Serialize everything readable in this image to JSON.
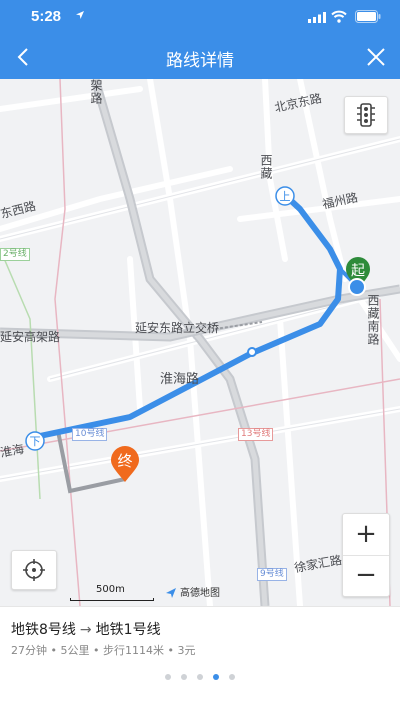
{
  "status": {
    "time": "5:28"
  },
  "navbar": {
    "title": "路线详情"
  },
  "map": {
    "labels": {
      "beijing_east": "北京东路",
      "xizang": "西藏",
      "fuzhou": "福州路",
      "dongxi": "东西路",
      "yanan_high": "延安高架路",
      "yanan_east": "延安东路立交桥",
      "huaihai": "淮海路",
      "huaihai_left": "淮海",
      "xizang_south": "西藏南路",
      "xujiahui": "徐家汇路",
      "top_left": "架路"
    },
    "metro": {
      "line10": "10号线",
      "line13": "13号线",
      "line9": "9号线",
      "line2": "2号线"
    },
    "markers": {
      "start": "起",
      "end": "终",
      "up": "上",
      "down": "下"
    },
    "zoom_in": "+",
    "zoom_out": "−",
    "scale_label": "500m",
    "provider": "高德地图"
  },
  "route": {
    "from_line": "地铁8号线",
    "arrow": "→",
    "to_line": "地铁1号线",
    "duration": "27分钟",
    "distance": "5公里",
    "walk": "步行1114米",
    "price": "3元",
    "sep": "•"
  },
  "pager": {
    "count": 5,
    "active_index": 3
  },
  "colors": {
    "primary": "#3b8ee8",
    "start_green": "#2e8b3a",
    "end_orange": "#f06a1d"
  }
}
